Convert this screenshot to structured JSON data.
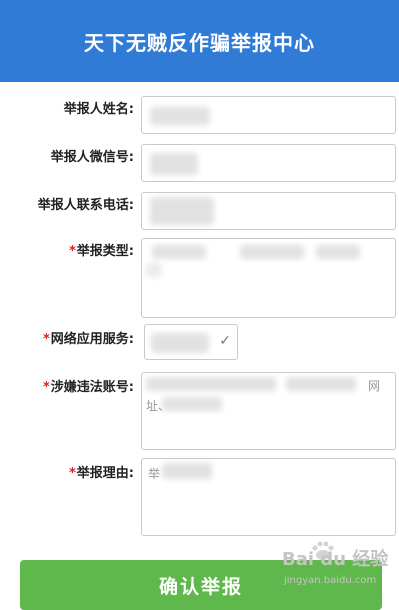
{
  "header": {
    "title": "天下无贼反作骗举报中心"
  },
  "form": {
    "fields": [
      {
        "label": "举报人姓名:",
        "required": false
      },
      {
        "label": "举报人微信号:",
        "required": false
      },
      {
        "label": "举报人联系电话:",
        "required": false
      },
      {
        "label": "举报类型:",
        "required": true
      },
      {
        "label": "网络应用服务:",
        "required": true
      },
      {
        "label": "涉嫌违法账号:",
        "required": true,
        "value_hint": "网\n址、"
      },
      {
        "label": "举报理由:",
        "required": true,
        "value_hint": "举"
      }
    ],
    "required_mark": "*"
  },
  "submit": {
    "label": "确认举报"
  },
  "watermark": {
    "logo": "Bai du 经验",
    "url": "jingyan.baidu.com"
  },
  "colors": {
    "header": "#2f7bd5",
    "submit": "#5fb84b",
    "required": "#e02020"
  }
}
